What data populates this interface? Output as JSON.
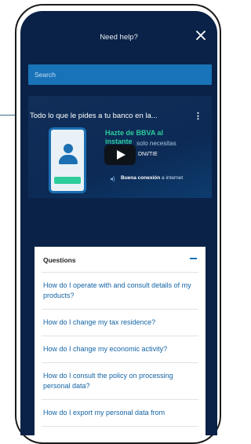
{
  "header": {
    "title": "Need help?"
  },
  "search": {
    "placeholder": "Search"
  },
  "video": {
    "title": "Todo lo que le pides a tu banco en la...",
    "promo_title": "Hazte de BBVA al instante",
    "promo_subtitle": "solo necesitas",
    "promo_tag": "DNI/TIE",
    "promo_connection_bold": "Buena conexión",
    "promo_connection_rest": "a internet"
  },
  "questions": {
    "header": "Questions",
    "items": [
      "How do I operate with and consult details of my products?",
      "How do I change my tax residence?",
      "How do I change my economic activity?",
      "How do I consult the policy on processing personal data?",
      "How do I export my personal data from"
    ]
  },
  "colors": {
    "screen_bg": "#0a2247",
    "search_bg": "#1973b8",
    "accent_green": "#2dcc9b",
    "link": "#1464a5"
  }
}
